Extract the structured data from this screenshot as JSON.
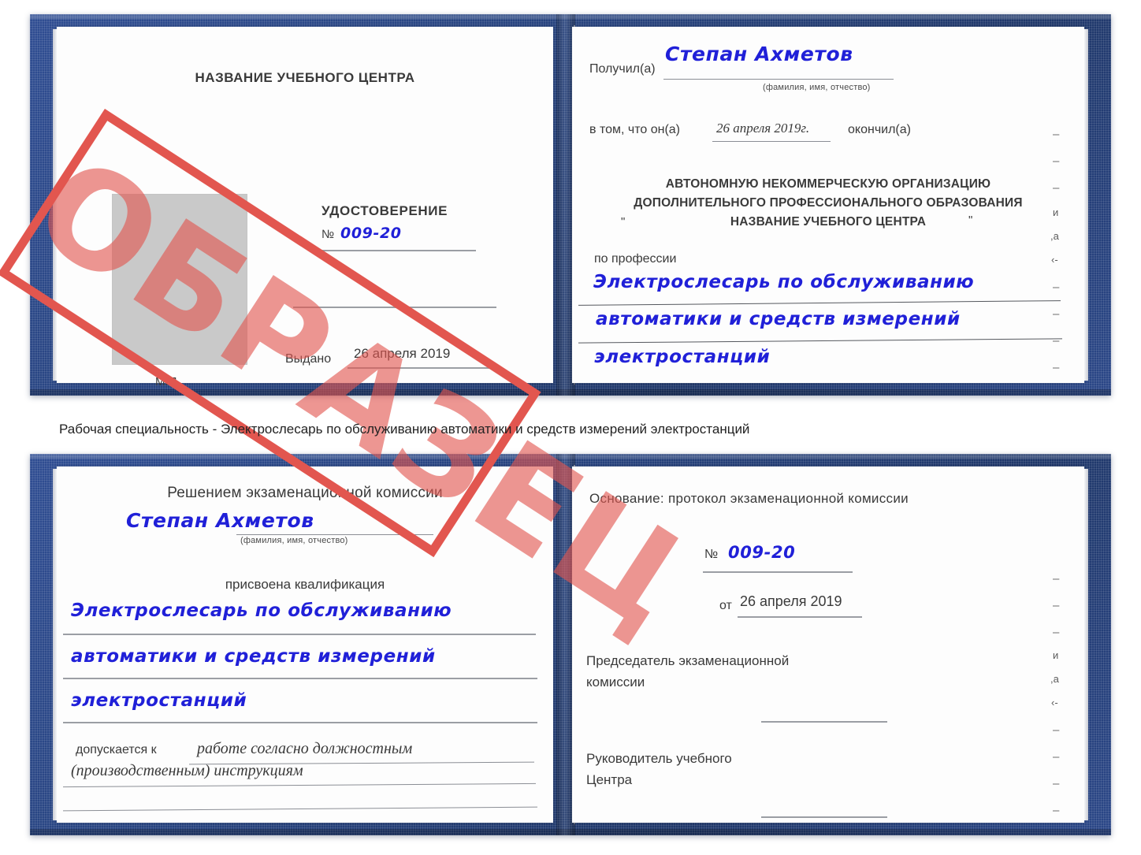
{
  "document": {
    "type": "Удостоверение",
    "watermark": "ОБРАЗЕЦ",
    "caption": "Рабочая специальность - Электрослесарь по обслуживанию автоматики и средств измерений электростанций",
    "cover_color": "#27437f",
    "handwriting_color": "#2020d8",
    "watermark_color": "#e2564f"
  },
  "top_spread": {
    "left_page": {
      "center_name": "НАЗВАНИЕ УЧЕБНОГО ЦЕНТРА",
      "title": "УДОСТОВЕРЕНИЕ",
      "number_label": "№",
      "number_value": "009-20",
      "issued_label": "Выдано",
      "issued_value": "26 апреля 2019",
      "seal_label": "М.П.",
      "photo_placeholder": "photo-box"
    },
    "right_page": {
      "received_label": "Получил(а)",
      "received_value": "Степан Ахметов",
      "received_hint": "(фамилия, имя, отчество)",
      "in_that_label": "в том, что он(а)",
      "completion_date": "26 апреля 2019г.",
      "finished_label": "окончил(а)",
      "org_line1": "АВТОНОМНУЮ НЕКОММЕРЧЕСКУЮ ОРГАНИЗАЦИЮ",
      "org_line2": "ДОПОЛНИТЕЛЬНОГО ПРОФЕССИОНАЛЬНОГО ОБРАЗОВАНИЯ",
      "org_quote_open": "\"",
      "org_line3": "НАЗВАНИЕ УЧЕБНОГО ЦЕНТРА",
      "org_quote_close": "\"",
      "profession_label": "по профессии",
      "profession_line1": "Электрослесарь по обслуживанию",
      "profession_line2": "автоматики и средств измерений",
      "profession_line3": "электростанций",
      "ghost_marks": [
        "–",
        "–",
        "–",
        "и",
        ",а",
        "‹-",
        "–",
        "–",
        "–",
        "–"
      ]
    }
  },
  "bottom_spread": {
    "left_page": {
      "heading": "Решением экзаменационной комиссии",
      "name_value": "Степан Ахметов",
      "name_hint": "(фамилия, имя, отчество)",
      "qualification_label": "присвоена квалификация",
      "qualification_line1": "Электрослесарь по обслуживанию",
      "qualification_line2": "автоматики и средств измерений",
      "qualification_line3": "электростанций",
      "admitted_label": "допускается к",
      "admitted_line1": "работе согласно должностным",
      "admitted_line2": "(производственным) инструкциям"
    },
    "right_page": {
      "basis_label": "Основание: протокол экзаменационной комиссии",
      "number_label": "№",
      "number_value": "009-20",
      "date_label": "от",
      "date_value": "26 апреля 2019",
      "chairman_line1": "Председатель экзаменационной",
      "chairman_line2": "комиссии",
      "head_line1": "Руководитель учебного",
      "head_line2": "Центра",
      "ghost_marks": [
        "–",
        "–",
        "–",
        "и",
        ",а",
        "‹-",
        "–",
        "–",
        "–",
        "–"
      ]
    }
  }
}
